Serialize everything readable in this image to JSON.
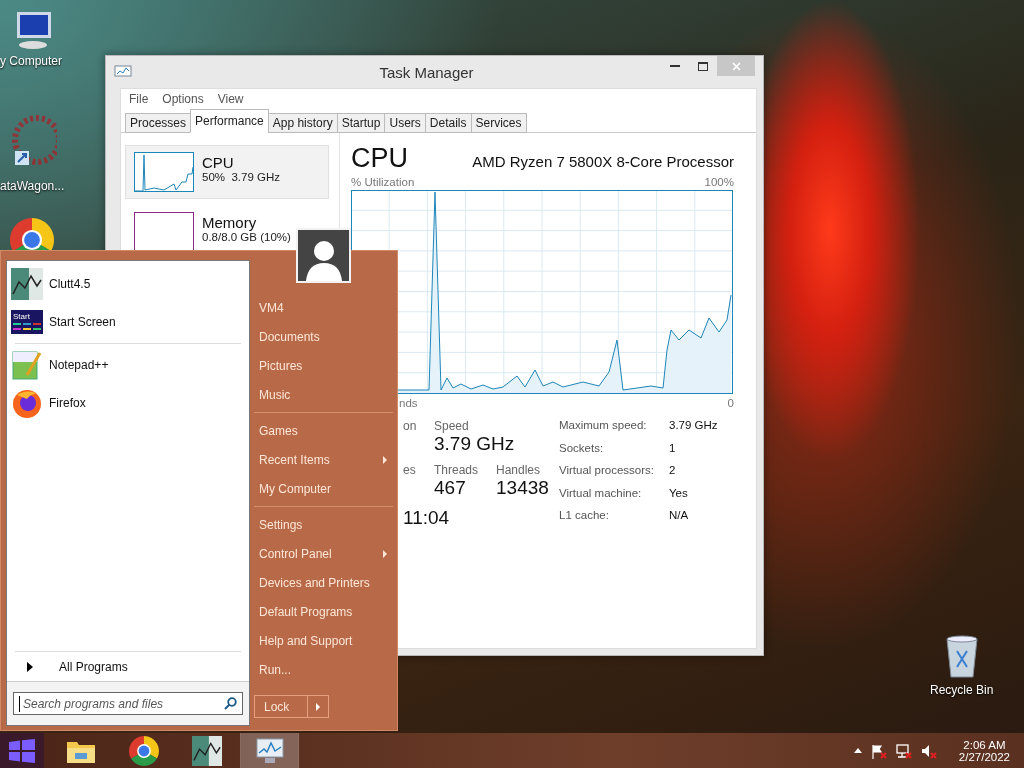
{
  "desktop": {
    "icons": [
      {
        "kind": "computer",
        "label": "y Computer"
      },
      {
        "kind": "shortcut",
        "label": "ataWagon..."
      },
      {
        "kind": "chrome"
      },
      {
        "kind": "recycle",
        "label": "Recycle Bin"
      }
    ]
  },
  "task_manager": {
    "title": "Task Manager",
    "menu": [
      "File",
      "Options",
      "View"
    ],
    "tabs": [
      {
        "label": "Processes",
        "selected": false
      },
      {
        "label": "Performance",
        "selected": true
      },
      {
        "label": "App history",
        "selected": false
      },
      {
        "label": "Startup",
        "selected": false
      },
      {
        "label": "Users",
        "selected": false
      },
      {
        "label": "Details",
        "selected": false
      },
      {
        "label": "Services",
        "selected": false
      }
    ],
    "sidebar": [
      {
        "kind": "cpu",
        "name": "CPU",
        "detail": "50%  3.79 GHz",
        "selected": true
      },
      {
        "kind": "memory",
        "name": "Memory",
        "detail": "0.8/8.0 GB (10%)",
        "selected": false
      }
    ],
    "heading": "CPU",
    "processor": "AMD Ryzen 7 5800X 8-Core Processor",
    "graph": {
      "label": "% Utilization",
      "max": "100%",
      "time": "nds",
      "min": "0"
    },
    "stat_rows": [
      [
        {
          "label": "on"
        },
        {
          "label": "Speed",
          "value": "3.79 GHz"
        }
      ],
      [
        {
          "label": "es"
        },
        {
          "label": "Threads",
          "value": "467"
        },
        {
          "label": "Handles",
          "value": "13438"
        }
      ],
      [
        {
          "value": "11:04"
        }
      ]
    ],
    "properties": [
      {
        "label": "Maximum speed:",
        "value": "3.79 GHz"
      },
      {
        "label": "Sockets:",
        "value": "1"
      },
      {
        "label": "Virtual processors:",
        "value": "2"
      },
      {
        "label": "Virtual machine:",
        "value": "Yes"
      },
      {
        "label": "L1 cache:",
        "value": "N/A"
      }
    ]
  },
  "start_menu": {
    "pinned": [
      {
        "kind": "clutt",
        "label": "Clutt4.5"
      },
      {
        "kind": "startscreen",
        "label": "Start Screen",
        "badge": "Start"
      }
    ],
    "recent": [
      {
        "kind": "notepad",
        "label": "Notepad++"
      },
      {
        "kind": "firefox",
        "label": "Firefox"
      }
    ],
    "all_programs": "All Programs",
    "search": {
      "placeholder": "Search programs and files"
    },
    "places": [
      [
        {
          "label": "VM4",
          "submenu": false
        },
        {
          "label": "Documents",
          "submenu": false
        },
        {
          "label": "Pictures",
          "submenu": false
        },
        {
          "label": "Music",
          "submenu": false
        }
      ],
      [
        {
          "label": "Games",
          "submenu": false
        },
        {
          "label": "Recent Items",
          "submenu": true
        },
        {
          "label": "My Computer",
          "submenu": false
        }
      ],
      [
        {
          "label": "Settings",
          "submenu": false
        },
        {
          "label": "Control Panel",
          "submenu": true
        },
        {
          "label": "Devices and Printers",
          "submenu": false
        },
        {
          "label": "Default Programs",
          "submenu": false
        },
        {
          "label": "Help and Support",
          "submenu": false
        },
        {
          "label": "Run...",
          "submenu": false
        }
      ]
    ],
    "lock": "Lock"
  },
  "taskbar": {
    "apps": [
      {
        "kind": "explorer",
        "selected": false
      },
      {
        "kind": "chrome",
        "selected": false
      },
      {
        "kind": "clutt",
        "selected": false
      },
      {
        "kind": "taskmanager",
        "selected": true
      }
    ],
    "tray": [
      {
        "kind": "arrow"
      },
      {
        "kind": "flag",
        "alert": true
      },
      {
        "kind": "network",
        "alert": true
      },
      {
        "kind": "volume",
        "alert": true
      }
    ],
    "clock": {
      "time": "2:06 AM",
      "date": "2/27/2022"
    }
  }
}
